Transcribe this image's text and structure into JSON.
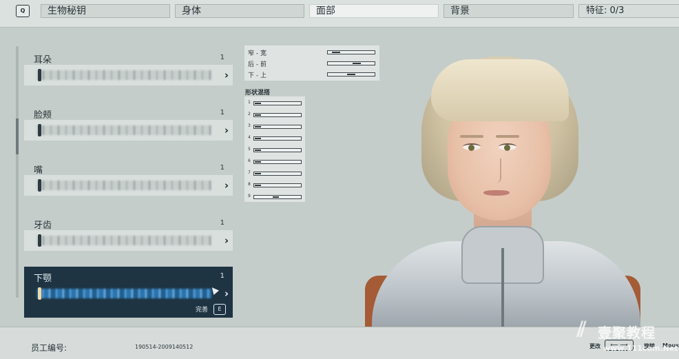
{
  "topbar": {
    "q_key": "Q",
    "tabs": [
      {
        "label": "生物秘钥"
      },
      {
        "label": "身体"
      },
      {
        "label": "面部"
      },
      {
        "label": "背景"
      }
    ],
    "traits_label": "特征: 0/3"
  },
  "features": [
    {
      "name": "耳朵",
      "value": "1"
    },
    {
      "name": "脸颊",
      "value": "1"
    },
    {
      "name": "嘴",
      "value": "1"
    },
    {
      "name": "牙齿",
      "value": "1"
    },
    {
      "name": "下颚",
      "value": "1",
      "done_label": "完善",
      "done_key": "E"
    }
  ],
  "dimension_sliders": [
    {
      "label": "窄 - 宽",
      "value": 0.1
    },
    {
      "label": "后 - 前",
      "value": 0.65
    },
    {
      "label": "下 - 上",
      "value": 0.5
    }
  ],
  "shape_blend": {
    "title": "形状混搭",
    "rows": [
      {
        "label": "1",
        "value": 0.02
      },
      {
        "label": "2",
        "value": 0.02
      },
      {
        "label": "3",
        "value": 0.02
      },
      {
        "label": "4",
        "value": 0.02
      },
      {
        "label": "5",
        "value": 0.02
      },
      {
        "label": "6",
        "value": 0.02
      },
      {
        "label": "7",
        "value": 0.02
      },
      {
        "label": "8",
        "value": 0.02
      },
      {
        "label": "9",
        "value": 0.45
      }
    ]
  },
  "bottombar": {
    "employee_label": "员工编号:",
    "employee_value": "190514-2009140512",
    "controls": {
      "change_label": "更改",
      "arrows": "⟵ ⟶",
      "rotate_label": "旋转",
      "mouse_label": "Mouse"
    }
  },
  "watermark": {
    "text": "壹聚教程",
    "url": "www.111com.Net"
  }
}
